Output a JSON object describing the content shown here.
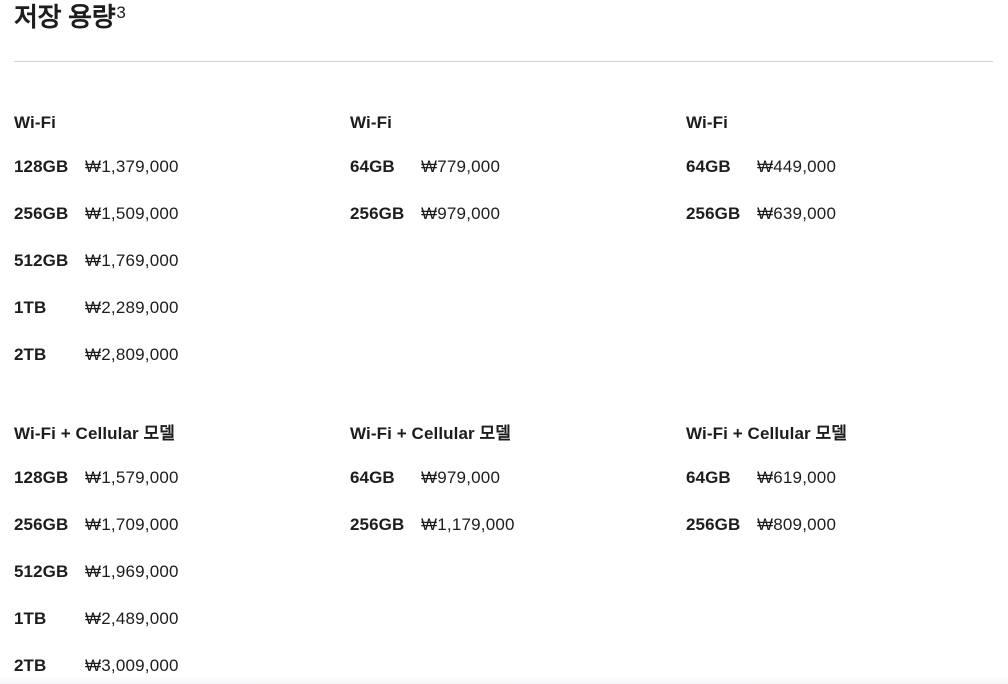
{
  "section": {
    "title": "저장 용량",
    "footnote": "3"
  },
  "columns": [
    {
      "wifi": {
        "title": "Wi-Fi",
        "options": [
          {
            "capacity": "128GB",
            "price": "₩1,379,000"
          },
          {
            "capacity": "256GB",
            "price": "₩1,509,000"
          },
          {
            "capacity": "512GB",
            "price": "₩1,769,000"
          },
          {
            "capacity": "1TB",
            "price": "₩2,289,000"
          },
          {
            "capacity": "2TB",
            "price": "₩2,809,000"
          }
        ]
      },
      "cellular": {
        "title": "Wi-Fi + Cellular 모델",
        "options": [
          {
            "capacity": "128GB",
            "price": "₩1,579,000"
          },
          {
            "capacity": "256GB",
            "price": "₩1,709,000"
          },
          {
            "capacity": "512GB",
            "price": "₩1,969,000"
          },
          {
            "capacity": "1TB",
            "price": "₩2,489,000"
          },
          {
            "capacity": "2TB",
            "price": "₩3,009,000"
          }
        ]
      }
    },
    {
      "wifi": {
        "title": "Wi-Fi",
        "options": [
          {
            "capacity": "64GB",
            "price": "₩779,000"
          },
          {
            "capacity": "256GB",
            "price": "₩979,000"
          }
        ]
      },
      "cellular": {
        "title": "Wi-Fi + Cellular 모델",
        "options": [
          {
            "capacity": "64GB",
            "price": "₩979,000"
          },
          {
            "capacity": "256GB",
            "price": "₩1,179,000"
          }
        ]
      }
    },
    {
      "wifi": {
        "title": "Wi-Fi",
        "options": [
          {
            "capacity": "64GB",
            "price": "₩449,000"
          },
          {
            "capacity": "256GB",
            "price": "₩639,000"
          }
        ]
      },
      "cellular": {
        "title": "Wi-Fi + Cellular 모델",
        "options": [
          {
            "capacity": "64GB",
            "price": "₩619,000"
          },
          {
            "capacity": "256GB",
            "price": "₩809,000"
          }
        ]
      }
    }
  ]
}
